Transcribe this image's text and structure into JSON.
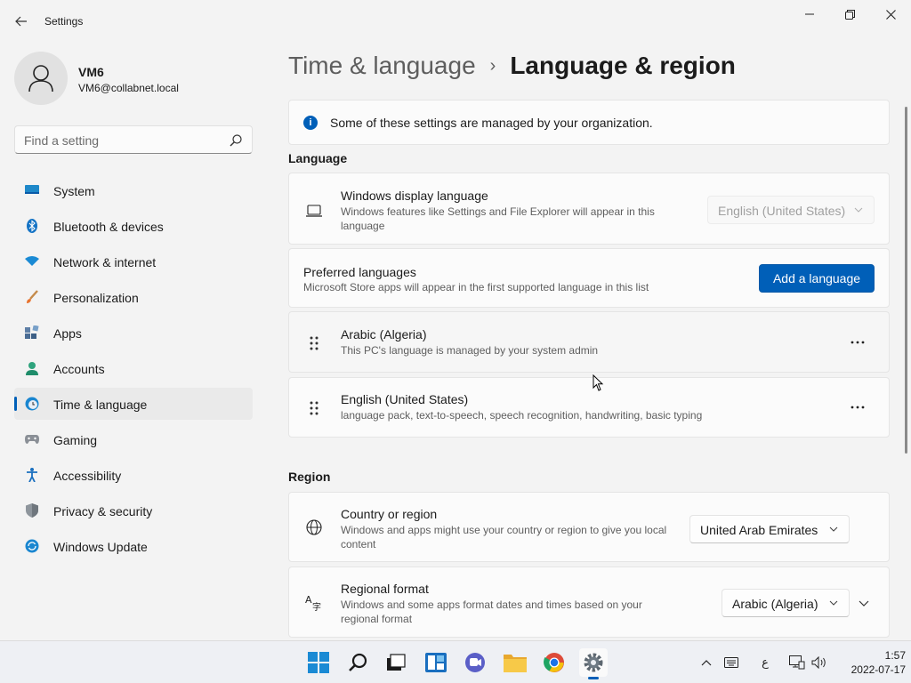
{
  "window": {
    "title": "Settings",
    "back_icon": "back-arrow-icon",
    "minimize_icon": "minimize-icon",
    "maximize_icon": "restore-icon",
    "close_icon": "close-icon"
  },
  "profile": {
    "name": "VM6",
    "email": "VM6@collabnet.local"
  },
  "search": {
    "placeholder": "Find a setting"
  },
  "sidebar": {
    "items": [
      {
        "label": "System",
        "icon": "system-icon"
      },
      {
        "label": "Bluetooth & devices",
        "icon": "bluetooth-icon"
      },
      {
        "label": "Network & internet",
        "icon": "network-icon"
      },
      {
        "label": "Personalization",
        "icon": "brush-icon"
      },
      {
        "label": "Apps",
        "icon": "apps-icon"
      },
      {
        "label": "Accounts",
        "icon": "accounts-icon"
      },
      {
        "label": "Time & language",
        "icon": "time-language-icon",
        "active": true
      },
      {
        "label": "Gaming",
        "icon": "gaming-icon"
      },
      {
        "label": "Accessibility",
        "icon": "accessibility-icon"
      },
      {
        "label": "Privacy & security",
        "icon": "shield-icon"
      },
      {
        "label": "Windows Update",
        "icon": "windows-update-icon"
      }
    ]
  },
  "breadcrumb": {
    "parent": "Time & language",
    "separator": "›",
    "current": "Language & region"
  },
  "info_bar": {
    "text": "Some of these settings are managed by your organization."
  },
  "language_section": {
    "title": "Language",
    "display_language": {
      "title": "Windows display language",
      "description": "Windows features like Settings and File Explorer will appear in this language",
      "value": "English (United States)"
    },
    "preferred": {
      "title": "Preferred languages",
      "description": "Microsoft Store apps will appear in the first supported language in this list",
      "button": "Add a language"
    },
    "languages": [
      {
        "name": "Arabic (Algeria)",
        "detail": "This PC's language is managed by your system admin"
      },
      {
        "name": "English (United States)",
        "detail": "language pack, text-to-speech, speech recognition, handwriting, basic typing"
      }
    ]
  },
  "region_section": {
    "title": "Region",
    "country": {
      "title": "Country or region",
      "description": "Windows and apps might use your country or region to give you local content",
      "value": "United Arab Emirates"
    },
    "format": {
      "title": "Regional format",
      "description": "Windows and some apps format dates and times based on your regional format",
      "value": "Arabic (Algeria)"
    }
  },
  "taskbar": {
    "apps": [
      "start-icon",
      "search-icon",
      "task-view-icon",
      "widgets-icon",
      "teams-chat-icon",
      "file-explorer-icon",
      "chrome-icon",
      "settings-icon"
    ],
    "tray": {
      "keyboard_lang": "ع",
      "time": "1:57",
      "date": "2022-07-17"
    }
  },
  "colors": {
    "accent": "#005fb8",
    "background": "#f3f3f3",
    "card": "#fbfbfb"
  }
}
